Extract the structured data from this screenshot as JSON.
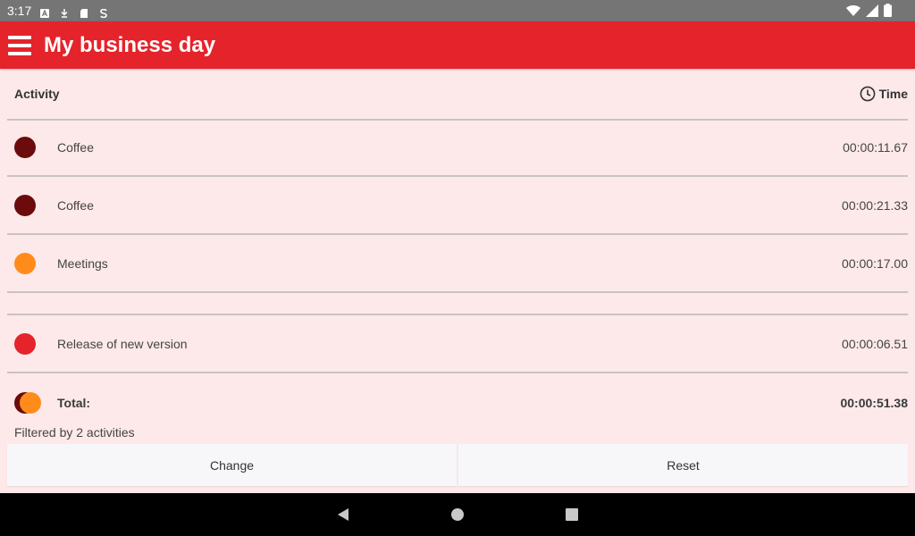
{
  "status_bar": {
    "time": "3:17",
    "icons": [
      "a-notification-icon",
      "download-icon",
      "sd-card-icon",
      "s-notification-icon"
    ],
    "right_icons": [
      "wifi-icon",
      "signal-icon",
      "battery-icon"
    ]
  },
  "app_bar": {
    "title": "My business day",
    "color": "#e5232b"
  },
  "table": {
    "header": {
      "activity": "Activity",
      "time": "Time"
    },
    "rows": [
      {
        "name": "Coffee",
        "time": "00:00:11.67",
        "color": "#6b0b0b"
      },
      {
        "name": "Coffee",
        "time": "00:00:21.33",
        "color": "#6b0b0b"
      },
      {
        "name": "Meetings",
        "time": "00:00:17.00",
        "color": "#ff8c1a"
      },
      {
        "name": "Release of new version",
        "time": "00:00:06.51",
        "color": "#e5232b"
      }
    ],
    "total": {
      "label": "Total:",
      "time": "00:00:51.38",
      "colors": [
        "#6b0b0b",
        "#ff8c1a"
      ]
    }
  },
  "filter": {
    "text": "Filtered by 2 activities"
  },
  "buttons": {
    "change": "Change",
    "reset": "Reset"
  },
  "nav_bar": {
    "icons": [
      "back-icon",
      "home-icon",
      "recents-icon"
    ]
  }
}
